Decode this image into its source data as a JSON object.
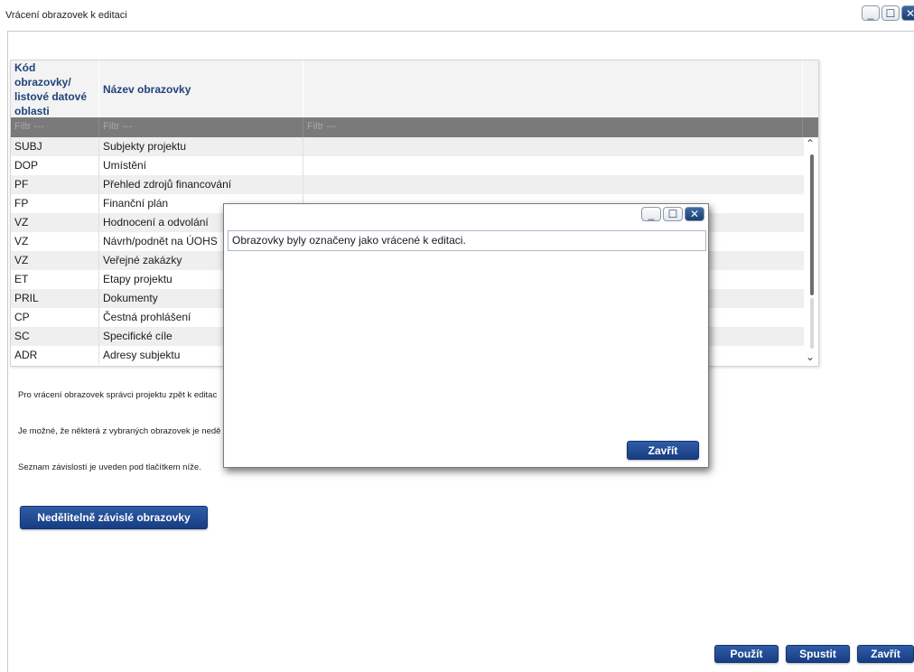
{
  "window": {
    "title": "Vrácení obrazovek k editaci",
    "controls": {
      "minimize": "_",
      "maximize": "☐",
      "close": "✕"
    }
  },
  "grid": {
    "headers": [
      "Kód obrazovky/ listové datové oblasti",
      "Název obrazovky",
      ""
    ],
    "filter_placeholder": "Filtr ---",
    "rows": [
      {
        "code": "SUBJ",
        "name": "Subjekty projektu"
      },
      {
        "code": "DOP",
        "name": "Umístění"
      },
      {
        "code": "PF",
        "name": "Přehled zdrojů financování"
      },
      {
        "code": "FP",
        "name": "Finanční plán"
      },
      {
        "code": "VZ",
        "name": "Hodnocení a odvolání"
      },
      {
        "code": "VZ",
        "name": "Návrh/podnět na ÚOHS"
      },
      {
        "code": "VZ",
        "name": "Veřejné zakázky"
      },
      {
        "code": "ET",
        "name": "Etapy projektu"
      },
      {
        "code": "PRIL",
        "name": "Dokumenty"
      },
      {
        "code": "CP",
        "name": "Čestná prohlášení"
      },
      {
        "code": "SC",
        "name": "Specifické cíle"
      },
      {
        "code": "ADR",
        "name": "Adresy subjektu"
      }
    ]
  },
  "info": {
    "line1": "Pro vrácení obrazovek správci projektu zpět k editac",
    "line2": "Je možné, že některá z vybraných obrazovek je nedě",
    "line3": "Seznam závislostí je uveden pod tlačítkem níže."
  },
  "buttons": {
    "dependent": "Nedělitelně závislé obrazovky",
    "apply": "Použít",
    "run": "Spustit",
    "close": "Zavřít"
  },
  "dialog": {
    "message": "Obrazovky byly označeny jako vrácené k editaci.",
    "close_label": "Zavřít"
  },
  "colors": {
    "accent": "#21437a",
    "button": "#1f4a92",
    "filter_bg": "#7a7a7a"
  }
}
